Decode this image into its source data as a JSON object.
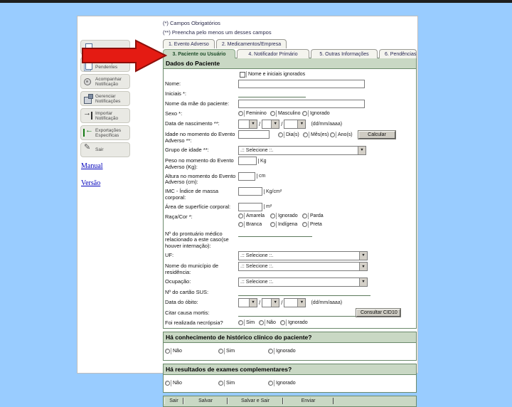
{
  "notes": [
    "(*) Campos Obrigatórios",
    "(**) Preencha pelo menos um desses campos"
  ],
  "sidebar": {
    "items": [
      {
        "label": "",
        "icon": "document-icon"
      },
      {
        "label": "Notificações Pendentes",
        "icon": "pages-icon"
      },
      {
        "label": "Acompanhar Notificação",
        "icon": "track-icon"
      },
      {
        "label": "Gerenciar Notificações",
        "icon": "disk-icon"
      },
      {
        "label": "Importar Notificação",
        "icon": "import-arrow-icon"
      },
      {
        "label": "Exportações Específicas",
        "icon": "export-arrow-icon"
      },
      {
        "label": "Sair",
        "icon": "exit-pen-icon"
      }
    ],
    "links": [
      "Manual",
      "Versão"
    ]
  },
  "tabs": {
    "row1": [
      "1. Evento Adverso",
      "2. Medicamentos/Empresa"
    ],
    "row2": [
      "3. Paciente ou Usuário",
      "4. Notificador Primário",
      "5. Outras Informações",
      "6. Pendências"
    ]
  },
  "form": {
    "header": "Dados do Paciente",
    "fields": {
      "ignored_checkbox": "Nome e iniciais ignorados",
      "nome": "Nome:",
      "iniciais": "Iniciais *:",
      "nome_mae": "Nome da mãe do paciente:",
      "sexo": {
        "label": "Sexo *:",
        "options": [
          "Feminino",
          "Masculino",
          "Ignorado"
        ]
      },
      "data_nascimento": {
        "label": "Data de nascimento **:",
        "hint": "(dd/mm/aaaa)"
      },
      "idade": {
        "label": "Idade no momento do Evento Adverso **:",
        "options": [
          "Dia(s)",
          "Mês(es)",
          "Ano(s)"
        ],
        "button": "Calcular"
      },
      "grupo_idade": {
        "label": "Grupo de idade **:",
        "value": ".:: Selecione ::."
      },
      "peso": {
        "label": "Peso no momento do Evento Adverso (Kg):",
        "unit": "Kg"
      },
      "altura": {
        "label": "Altura no momento do Evento Adverso (cm):",
        "unit": "cm"
      },
      "imc": {
        "label": "IMC - Índice de massa corporal:",
        "unit": "Kg/cm²"
      },
      "superficie": {
        "label": "Área de superfície corporal:",
        "unit": "m²"
      },
      "raca": {
        "label": "Raça/Cor *:",
        "row1": [
          "Amarela",
          "Ignorado",
          "Parda"
        ],
        "row2": [
          "Branca",
          "Indígena",
          "Preta"
        ]
      },
      "prontuario": "Nº do prontuário médico relacionado a este caso(se houver internação):",
      "uf": {
        "label": "UF:",
        "value": ".:: Selecione ::."
      },
      "municipio": {
        "label": "Nome do município de residência:",
        "value": ".:: Selecione ::."
      },
      "ocupacao": {
        "label": "Ocupação:",
        "value": ".:: Selecione ::."
      },
      "cartao_sus": "Nº do cartão SUS:",
      "data_obito": {
        "label": "Data do óbito:",
        "hint": "(dd/mm/aaaa)"
      },
      "causa_mortis": {
        "label": "Citar causa mortis:",
        "button": "Consultar CID10"
      },
      "necropsia": {
        "label": "Foi realizada necrópsia?",
        "options": [
          "Sim",
          "Não",
          "Ignorado"
        ]
      }
    }
  },
  "sections": [
    {
      "title": "Há conhecimento de histórico clínico do paciente?",
      "options": [
        "Não",
        "Sim",
        "Ignorado"
      ]
    },
    {
      "title": "Há resultados de exames complementares?",
      "options": [
        "Não",
        "Sim",
        "Ignorado"
      ]
    }
  ],
  "footer": {
    "buttons": [
      "Sair",
      "Salvar",
      "Salvar e Sair",
      "Enviar"
    ]
  },
  "colors": {
    "background": "#99ccff",
    "panel_green": "#c9d8c4",
    "border_green": "#6b8a6b",
    "arrow_red": "#e41b13"
  }
}
